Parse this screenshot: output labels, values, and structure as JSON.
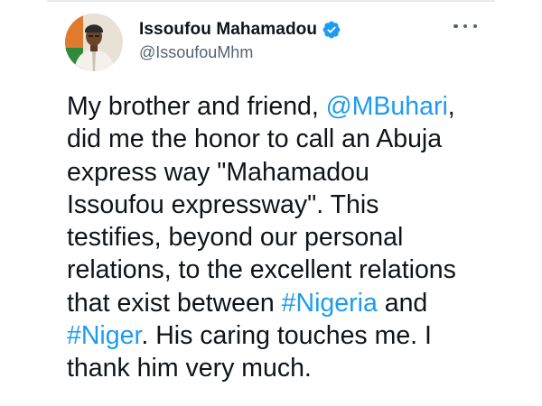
{
  "tweet": {
    "author": {
      "display_name": "Issoufou Mahamadou",
      "handle": "@IssoufouMhm",
      "verified": true
    },
    "text_segments": [
      {
        "text": "My brother and friend, ",
        "type": "text"
      },
      {
        "text": "@MBuhari",
        "type": "mention"
      },
      {
        "text": ",\ndid me the honor to call an Abuja\nexpress way \"Mahamadou\nIssoufou expressway\". This\ntestifies, beyond our personal\nrelations, to the excellent relations\nthat exist between ",
        "type": "text"
      },
      {
        "text": "#Nigeria",
        "type": "hashtag"
      },
      {
        "text": " and\n",
        "type": "text"
      },
      {
        "text": "#Niger",
        "type": "hashtag"
      },
      {
        "text": ". His caring touches me. I\nthank him very much.",
        "type": "text"
      }
    ]
  },
  "colors": {
    "link": "#1d9bf0",
    "text": "#0f1419",
    "secondary": "#536471",
    "verified_badge": "#1d9bf0"
  },
  "icons": {
    "verified": "verified-badge-icon",
    "more": "more-options-icon"
  }
}
